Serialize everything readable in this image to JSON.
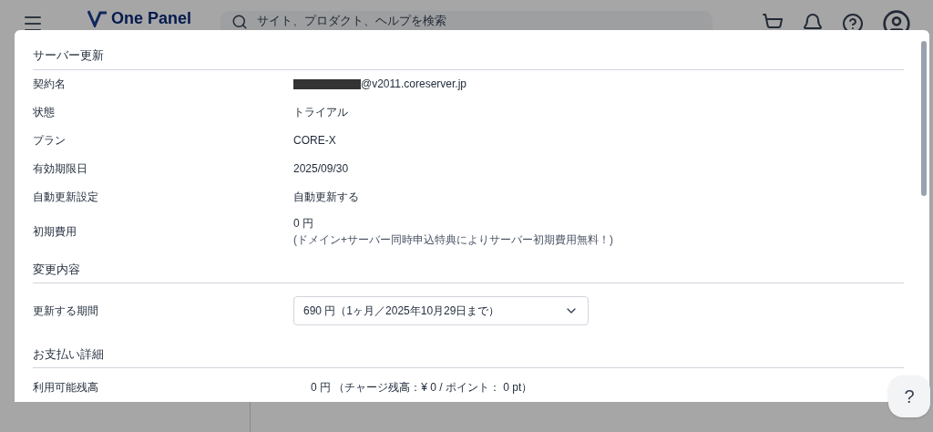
{
  "header": {
    "logo": "One Panel",
    "search": {
      "placeholder": "サイト、プロダクト、ヘルプを検索"
    }
  },
  "dialog": {
    "title": "サーバー更新",
    "rows": [
      {
        "label": "契約名",
        "value": "@v2011.coreserver.jp",
        "redacted": true
      },
      {
        "label": "状態",
        "value": "トライアル",
        "redacted": false
      },
      {
        "label": "プラン",
        "value": "CORE-X",
        "redacted": false
      },
      {
        "label": "有効期限日",
        "value": "2025/09/30",
        "redacted": false
      },
      {
        "label": "自動更新設定",
        "value": "自動更新する",
        "redacted": false
      },
      {
        "label": "初期費用",
        "value": "0 円",
        "note": "(ドメイン+サーバー同時申込特典によりサーバー初期費用無料！)",
        "redacted": false
      }
    ],
    "change_section": {
      "title": "変更内容",
      "label": "更新する期間",
      "select": "690 円（1ヶ月／2025年10月29日まで）"
    },
    "payment_section": {
      "title": "お支払い詳細",
      "label": "利用可能残高",
      "value": "0 円 （チャージ残高：¥ 0 / ポイント： 0 pt）"
    }
  },
  "help_button": "?"
}
